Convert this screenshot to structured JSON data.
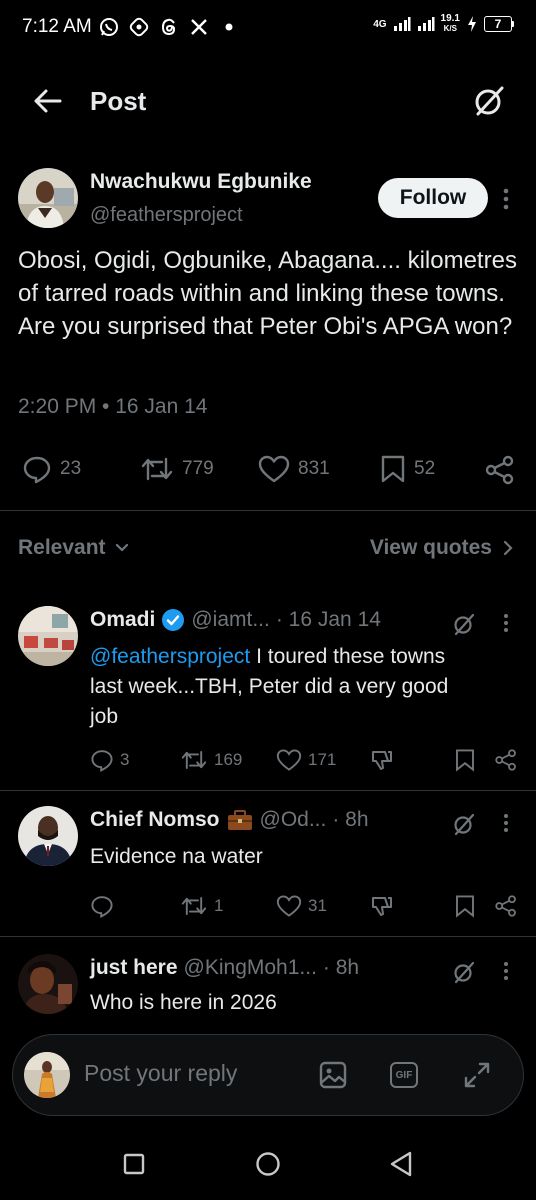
{
  "status_bar": {
    "time": "7:12 AM",
    "network": "4G",
    "speed_value": "19.1",
    "speed_unit": "K/S",
    "battery": "7",
    "app_icons": [
      "whatsapp-icon",
      "app-icon",
      "threads-icon",
      "x-icon",
      "dot-icon"
    ]
  },
  "header": {
    "title": "Post"
  },
  "main_post": {
    "author_name": "Nwachukwu Egbunike",
    "author_handle": "@feathersproject",
    "follow_label": "Follow",
    "text": "Obosi, Ogidi, Ogbunike, Abagana.... kilometres of tarred roads within and linking these towns. Are you surprised that Peter Obi's APGA won?",
    "timestamp": "2:20 PM • 16 Jan 14",
    "stats": {
      "replies": "23",
      "reposts": "779",
      "likes": "831",
      "bookmarks": "52"
    }
  },
  "sort": {
    "relevant_label": "Relevant",
    "view_quotes_label": "View quotes"
  },
  "replies": [
    {
      "name": "Omadi",
      "handle": "@iamt...",
      "time": "· 16 Jan 14",
      "mention": "@feathersproject",
      "text": " I toured these towns last week...TBH, Peter did a very good job",
      "replies": "3",
      "reposts": "169",
      "likes": "171"
    },
    {
      "name": "Chief Nomso",
      "handle": "@Od...",
      "time": "· 8h",
      "text": "Evidence na water",
      "replies": "",
      "reposts": "1",
      "likes": "31"
    },
    {
      "name": "just here",
      "handle": "@KingMoh1...",
      "time": "· 8h",
      "text": "Who is here in 2026"
    }
  ],
  "reply_bar": {
    "placeholder": "Post your reply",
    "gif_label": "GIF"
  },
  "colors": {
    "background": "#000000",
    "text_primary": "#e7e9ea",
    "text_secondary": "#71767b",
    "link": "#1d9bf0",
    "verified": "#1d9bf0",
    "divider": "#2f3336"
  }
}
